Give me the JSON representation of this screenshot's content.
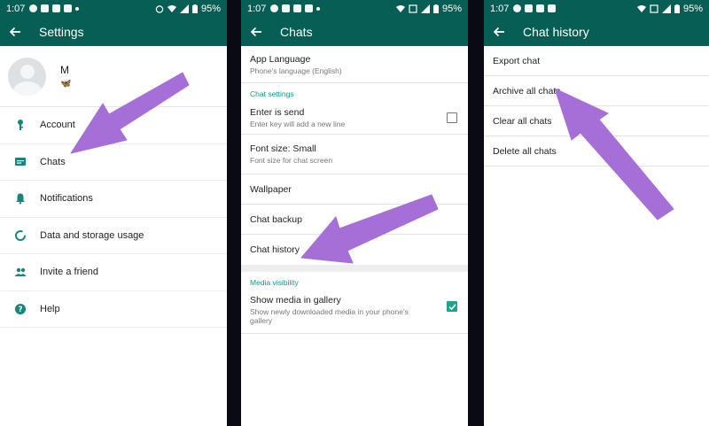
{
  "status_bar": {
    "time": "1:07",
    "battery": "95%"
  },
  "settings_screen": {
    "title": "Settings",
    "profile": {
      "name": "M",
      "status": "🦋"
    },
    "items": [
      {
        "label": "Account",
        "icon": "key-icon"
      },
      {
        "label": "Chats",
        "icon": "chat-icon"
      },
      {
        "label": "Notifications",
        "icon": "bell-icon"
      },
      {
        "label": "Data and storage usage",
        "icon": "data-usage-icon"
      },
      {
        "label": "Invite a friend",
        "icon": "people-icon"
      },
      {
        "label": "Help",
        "icon": "help-icon"
      }
    ]
  },
  "chats_screen": {
    "title": "Chats",
    "app_language": {
      "label": "App Language",
      "sub": "Phone's language (English)"
    },
    "chat_settings_header": "Chat settings",
    "enter_is_send": {
      "label": "Enter is send",
      "sub": "Enter key will add a new line",
      "checked": false
    },
    "font_size": {
      "label": "Font size: Small",
      "sub": "Font size for chat screen"
    },
    "wallpaper": "Wallpaper",
    "chat_backup": "Chat backup",
    "chat_history": "Chat history",
    "media_visibility_header": "Media visibility",
    "show_media": {
      "label": "Show media in gallery",
      "sub": "Show newly downloaded media in your phone's gallery",
      "checked": true
    }
  },
  "chat_history_screen": {
    "title": "Chat history",
    "items": [
      "Export chat",
      "Archive all chats",
      "Clear all chats",
      "Delete all chats"
    ]
  },
  "colors": {
    "header": "#075e54",
    "accent": "#1ea48a",
    "annotation_arrow": "#a66fd8"
  }
}
